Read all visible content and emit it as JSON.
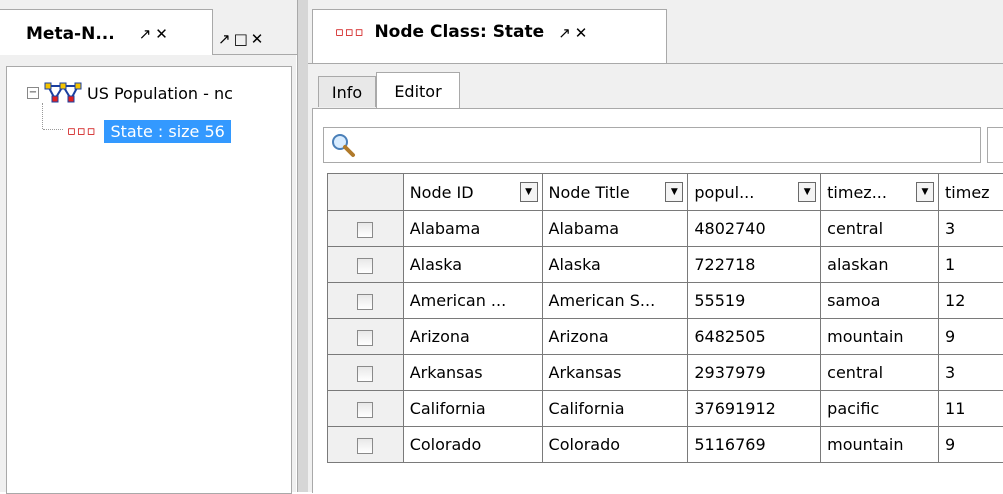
{
  "left_panel": {
    "tab_title": "Meta-N...",
    "tab_icons": "↗✕",
    "second_tab_icons": "↗□✕",
    "tree": {
      "root_label": "US Population - nc",
      "child_label": "State : size 56"
    }
  },
  "right_panel": {
    "tab_title": "Node Class: State",
    "tab_icons": "↗✕",
    "subtabs": [
      "Info",
      "Editor"
    ],
    "active_subtab": "Editor",
    "search": {
      "value": "",
      "placeholder": ""
    },
    "table": {
      "columns": [
        "Node ID",
        "Node Title",
        "popul...",
        "timez...",
        "timez"
      ],
      "rows": [
        [
          "Alabama",
          "Alabama",
          "4802740",
          "central",
          "3"
        ],
        [
          "Alaska",
          "Alaska",
          "722718",
          "alaskan",
          "1"
        ],
        [
          "American ...",
          "American S...",
          "55519",
          "samoa",
          "12"
        ],
        [
          "Arizona",
          "Arizona",
          "6482505",
          "mountain",
          "9"
        ],
        [
          "Arkansas",
          "Arkansas",
          "2937979",
          "central",
          "3"
        ],
        [
          "California",
          "California",
          "37691912",
          "pacific",
          "11"
        ],
        [
          "Colorado",
          "Colorado",
          "5116769",
          "mountain",
          "9"
        ]
      ]
    }
  },
  "colors": {
    "selection": "#3399ff",
    "node_icon": "#cc0000",
    "panel_bg": "#f0f0f0"
  },
  "icons": [
    "pin-icon",
    "close-icon",
    "maximize-icon",
    "search-icon",
    "dropdown-icon",
    "node-class-icon",
    "meta-network-icon"
  ]
}
